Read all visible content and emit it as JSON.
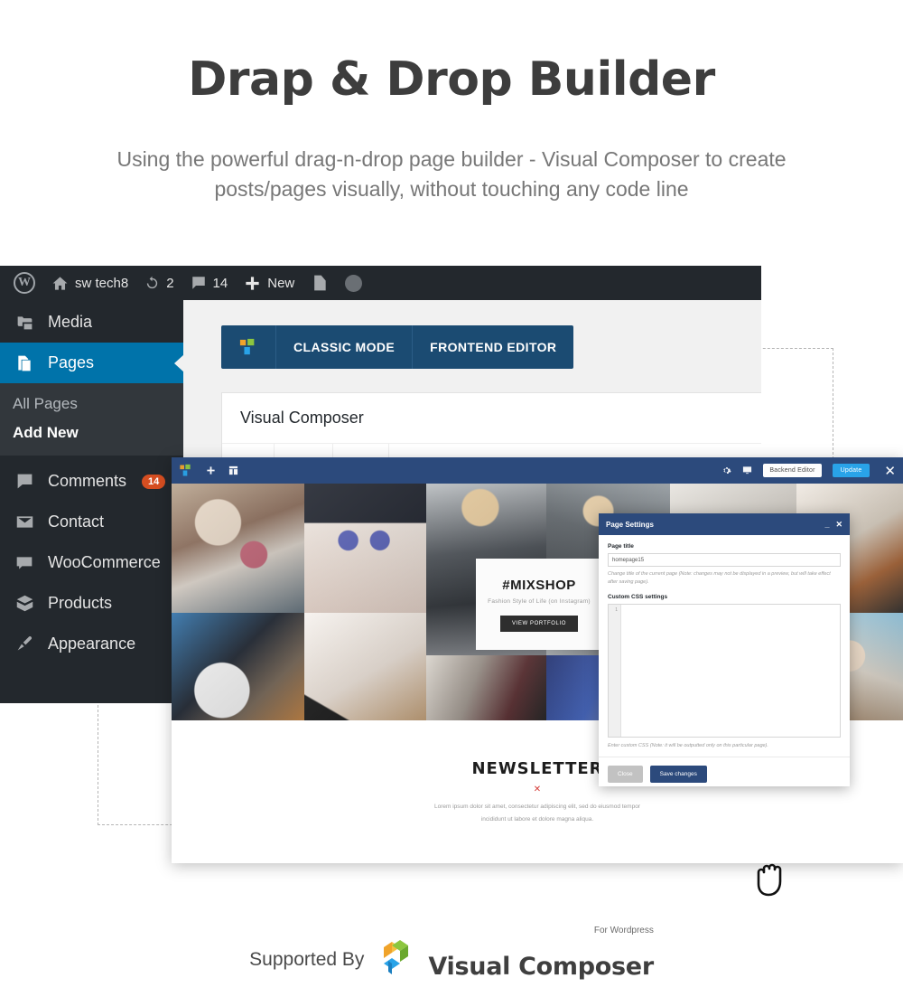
{
  "hero": {
    "title": "Drap & Drop Builder",
    "subtitle": "Using the powerful drag-n-drop page builder - Visual Composer to create posts/pages visually, without touching any code line"
  },
  "colors": {
    "wp_admin_dark": "#23282d",
    "wp_submenu_dark": "#32373c",
    "wp_active_blue": "#0073aa",
    "vc_blue": "#1b4b72",
    "fe_toolbar_blue": "#2c4a7c",
    "update_button_blue": "#29a3e8",
    "badge_orange": "#d54e21",
    "newsletter_x_red": "#d53b37"
  },
  "adminbar": {
    "logo_icon": "wordpress-logo-icon",
    "home_icon": "home-icon",
    "site_name": "sw tech8",
    "updates_icon": "updates-refresh-icon",
    "updates_count": "2",
    "comments_icon": "comment-bubble-icon",
    "comments_count": "14",
    "new_icon": "plus-icon",
    "new_label": "New",
    "yoast_icon": "yoast-seo-icon",
    "avatar_icon": "user-avatar-icon"
  },
  "sidebar": {
    "items": [
      {
        "label": "Media",
        "icon": "media-camera-icon",
        "active": false,
        "badge": ""
      },
      {
        "label": "Pages",
        "icon": "pages-icon",
        "active": true,
        "badge": ""
      },
      {
        "label": "Comments",
        "icon": "comment-bubble-icon",
        "active": false,
        "badge": "14"
      },
      {
        "label": "Contact",
        "icon": "envelope-icon",
        "active": false,
        "badge": ""
      },
      {
        "label": "WooCommerce",
        "icon": "woocommerce-icon",
        "active": false,
        "badge": ""
      },
      {
        "label": "Products",
        "icon": "products-box-icon",
        "active": false,
        "badge": ""
      },
      {
        "label": "Appearance",
        "icon": "paintbrush-icon",
        "active": false,
        "badge": ""
      }
    ],
    "submenu": [
      {
        "label": "All Pages",
        "selected": false
      },
      {
        "label": "Add New",
        "selected": true
      }
    ]
  },
  "vc_backend": {
    "logo_icon": "visual-composer-logo-icon",
    "mode_classic": "CLASSIC MODE",
    "mode_frontend": "FRONTEND EDITOR",
    "panel_title": "Visual Composer"
  },
  "frontend_editor": {
    "toolbar": {
      "logo_icon": "visual-composer-logo-icon",
      "add_element_icon": "plus-icon",
      "templates_icon": "grid-layout-icon",
      "settings_icon": "gear-icon",
      "responsive_icon": "monitor-icon",
      "backend_editor_label": "Backend Editor",
      "update_label": "Update",
      "close_icon": "close-x-icon"
    },
    "mixshop": {
      "title": "#MIXSHOP",
      "subtitle": "Fashion Style of Life (on Instagram)",
      "button": "VIEW PORTFOLIO"
    },
    "newsletter": {
      "title": "NEWSLETTER",
      "divider_mark": "✕",
      "copy_line1": "Lorem ipsum dolor sit amet, consectetur adipiscing elit, sed do eiusmod tempor",
      "copy_line2": "incididunt ut labore et dolore magna aliqua."
    }
  },
  "page_settings": {
    "title": "Page Settings",
    "minimize_icon": "minimize-icon",
    "close_icon": "close-x-icon",
    "page_title_label": "Page title",
    "page_title_value": "homepage15",
    "page_title_hint": "Change title of the current page (Note: changes may not be displayed in a preview, but will take effect after saving page).",
    "custom_css_label": "Custom CSS settings",
    "css_line_number": "1",
    "css_value": "",
    "css_hint": "Enter custom CSS (Note: it will be outputted only on this particular page).",
    "close_button": "Close",
    "save_button": "Save changes"
  },
  "cursor": {
    "icon": "grab-hand-cursor-icon"
  },
  "footer": {
    "supported_by": "Supported By",
    "logo_icon": "visual-composer-logo-icon",
    "brand": "Visual Composer",
    "tagline": "For Wordpress"
  }
}
